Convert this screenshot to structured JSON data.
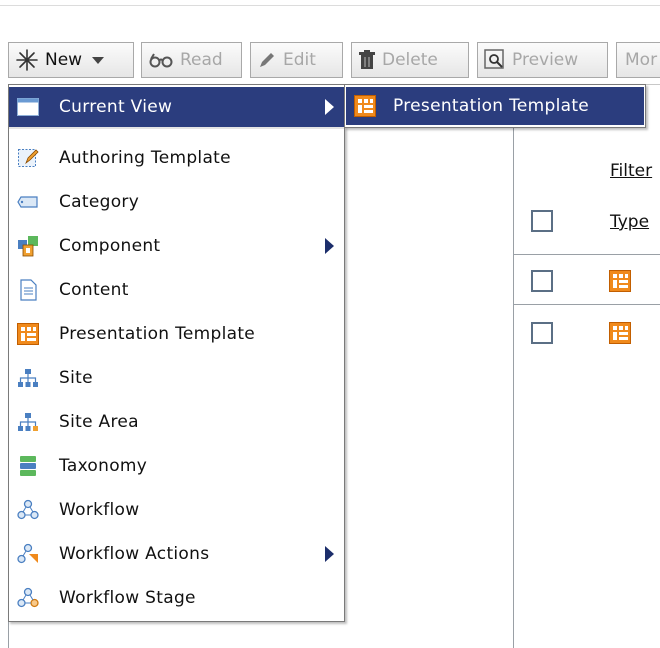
{
  "toolbar": {
    "new_label": "New",
    "read_label": "Read",
    "edit_label": "Edit",
    "delete_label": "Delete",
    "preview_label": "Preview",
    "more_label": "Mor"
  },
  "grid": {
    "filter_label": "Filter",
    "type_label": "Type",
    "rows": [
      {
        "icon": "presentation-template-icon"
      },
      {
        "icon": "presentation-template-icon"
      }
    ]
  },
  "menu": {
    "current_view": "Current View",
    "items": [
      {
        "label": "Authoring Template",
        "icon": "authoring-template-icon",
        "has_submenu": false
      },
      {
        "label": "Category",
        "icon": "category-icon",
        "has_submenu": false
      },
      {
        "label": "Component",
        "icon": "component-icon",
        "has_submenu": true
      },
      {
        "label": "Content",
        "icon": "content-icon",
        "has_submenu": false
      },
      {
        "label": "Presentation Template",
        "icon": "presentation-template-icon",
        "has_submenu": false
      },
      {
        "label": "Site",
        "icon": "site-icon",
        "has_submenu": false
      },
      {
        "label": "Site Area",
        "icon": "site-area-icon",
        "has_submenu": false
      },
      {
        "label": "Taxonomy",
        "icon": "taxonomy-icon",
        "has_submenu": false
      },
      {
        "label": "Workflow",
        "icon": "workflow-icon",
        "has_submenu": false
      },
      {
        "label": "Workflow Actions",
        "icon": "workflow-actions-icon",
        "has_submenu": true
      },
      {
        "label": "Workflow Stage",
        "icon": "workflow-stage-icon",
        "has_submenu": false
      }
    ]
  },
  "submenu": {
    "item_label": "Presentation Template"
  },
  "colors": {
    "menu_highlight": "#2b3d7e",
    "presentation_orange": "#f08a1c"
  }
}
